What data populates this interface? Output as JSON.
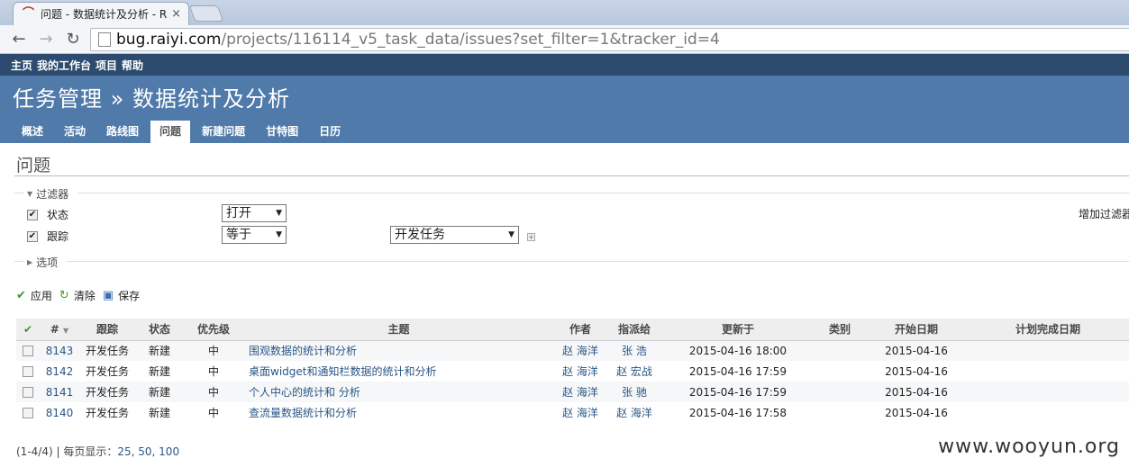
{
  "browser": {
    "tab_title": "问题 - 数据统计及分析 - R",
    "url_host": "bug.raiyi.com",
    "url_path": "/projects/116114_v5_task_data/issues?set_filter=1&tracker_id=4"
  },
  "topmenu": [
    "主页",
    "我的工作台",
    "项目",
    "帮助"
  ],
  "header": {
    "title": "任务管理 » 数据统计及分析"
  },
  "mainmenu": [
    "概述",
    "活动",
    "路线图",
    "问题",
    "新建问题",
    "甘特图",
    "日历"
  ],
  "page_title": "问题",
  "filters": {
    "legend": "过滤器",
    "status_label": "状态",
    "status_value": "打开",
    "tracker_label": "跟踪",
    "tracker_op": "等于",
    "tracker_value": "开发任务",
    "add_filter": "增加过滤器"
  },
  "options_legend": "选项",
  "actions": {
    "apply": "应用",
    "clear": "清除",
    "save": "保存"
  },
  "table": {
    "headers": [
      "#",
      "跟踪",
      "状态",
      "优先级",
      "主题",
      "作者",
      "指派给",
      "更新于",
      "类别",
      "开始日期",
      "计划完成日期"
    ],
    "rows": [
      {
        "id": "8143",
        "tracker": "开发任务",
        "status": "新建",
        "priority": "中",
        "subject": "围观数据的统计和分析",
        "author": "赵 海洋",
        "assignee": "张 浩",
        "updated": "2015-04-16 18:00",
        "category": "",
        "start": "2015-04-16",
        "due": ""
      },
      {
        "id": "8142",
        "tracker": "开发任务",
        "status": "新建",
        "priority": "中",
        "subject": "桌面widget和通知栏数据的统计和分析",
        "author": "赵 海洋",
        "assignee": "赵 宏战",
        "updated": "2015-04-16 17:59",
        "category": "",
        "start": "2015-04-16",
        "due": ""
      },
      {
        "id": "8141",
        "tracker": "开发任务",
        "status": "新建",
        "priority": "中",
        "subject": "个人中心的统计和 分析",
        "author": "赵 海洋",
        "assignee": "张 驰",
        "updated": "2015-04-16 17:59",
        "category": "",
        "start": "2015-04-16",
        "due": ""
      },
      {
        "id": "8140",
        "tracker": "开发任务",
        "status": "新建",
        "priority": "中",
        "subject": "查流量数据统计和分析",
        "author": "赵 海洋",
        "assignee": "赵 海洋",
        "updated": "2015-04-16 17:58",
        "category": "",
        "start": "2015-04-16",
        "due": ""
      }
    ]
  },
  "pagination": {
    "range": "(1-4/4)",
    "per_page_label": "每页显示：",
    "p25": "25",
    "p50": "50",
    "p100": "100"
  },
  "watermark": "www.wooyun.org"
}
